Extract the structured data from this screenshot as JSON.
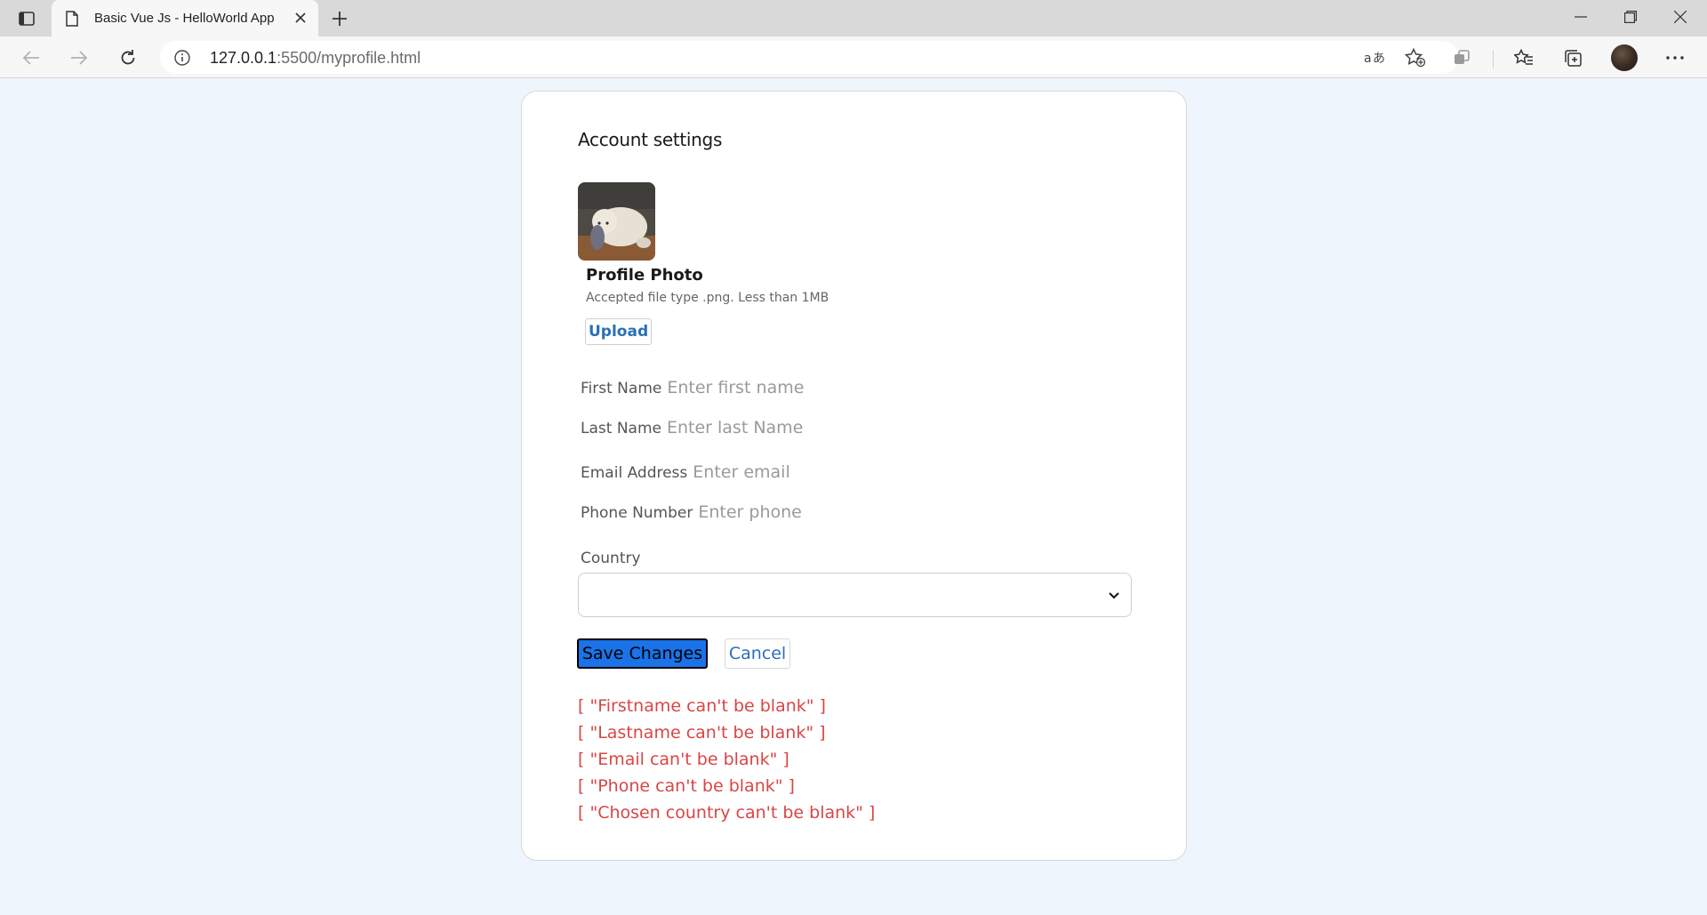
{
  "browser": {
    "tab_title": "Basic Vue Js - HelloWorld App",
    "url_host": "127.0.0.1",
    "url_path": ":5500/myprofile.html"
  },
  "page": {
    "title": "Account settings",
    "photo": {
      "label": "Profile Photo",
      "hint": "Accepted file type .png. Less than 1MB",
      "upload_label": "Upload"
    },
    "fields": {
      "first_name": {
        "label": "First Name",
        "placeholder": "Enter first name",
        "value": ""
      },
      "last_name": {
        "label": "Last Name",
        "placeholder": "Enter last Name",
        "value": ""
      },
      "email": {
        "label": "Email Address",
        "placeholder": "Enter email",
        "value": ""
      },
      "phone": {
        "label": "Phone Number",
        "placeholder": "Enter phone",
        "value": ""
      }
    },
    "country": {
      "label": "Country",
      "selected": ""
    },
    "actions": {
      "save_label": "Save Changes",
      "cancel_label": "Cancel"
    },
    "errors": [
      "[ \"Firstname can't be blank\" ]",
      "[ \"Lastname can't be blank\" ]",
      "[ \"Email can't be blank\" ]",
      "[ \"Phone can't be blank\" ]",
      "[ \"Chosen country can't be blank\" ]"
    ]
  },
  "colors": {
    "page_background": "#eff5fd",
    "link_blue": "#2a6fb8",
    "save_button": "#1a73e8",
    "error_red": "#d94545"
  },
  "icons": [
    "tab-actions-icon",
    "page-icon",
    "close-icon",
    "plus-icon",
    "minimize-icon",
    "maximize-icon",
    "window-close-icon",
    "back-icon",
    "forward-icon",
    "refresh-icon",
    "info-icon",
    "read-aloud-icon",
    "add-favorite-icon",
    "extensions-icon",
    "favorites-icon",
    "collections-icon",
    "more-icon",
    "chevron-down-icon"
  ]
}
